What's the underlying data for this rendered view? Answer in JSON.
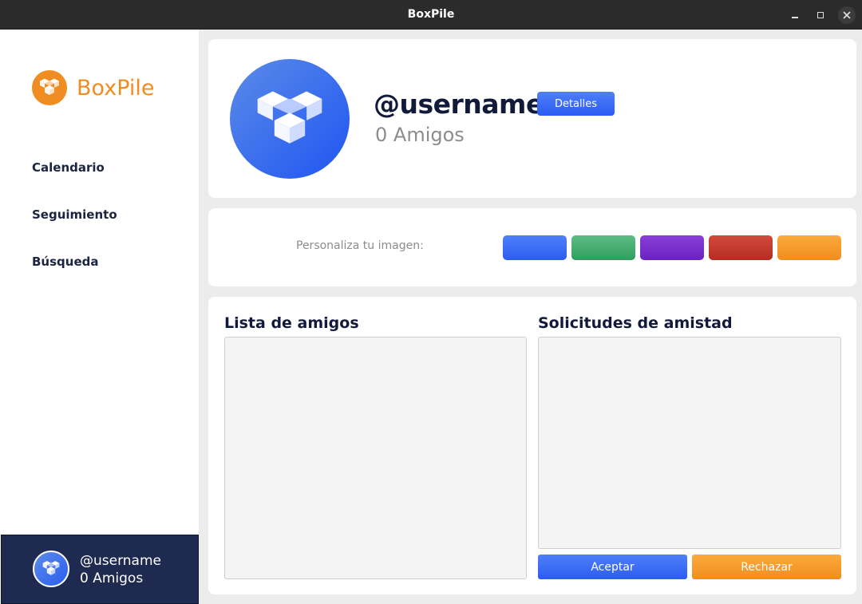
{
  "window": {
    "title": "BoxPile"
  },
  "sidebar": {
    "brand": "BoxPile",
    "nav": [
      {
        "label": "Calendario"
      },
      {
        "label": "Seguimiento"
      },
      {
        "label": "Búsqueda"
      }
    ],
    "user": {
      "username": "@username",
      "friends": "0 Amigos"
    }
  },
  "profile": {
    "username": "@username",
    "friends": "0 Amigos",
    "details_button": "Detalles"
  },
  "customize": {
    "label": "Personaliza tu imagen:",
    "colors": [
      {
        "name": "blue",
        "hex": "#3d6ef5"
      },
      {
        "name": "green",
        "hex": "#45ad70"
      },
      {
        "name": "purple",
        "hex": "#7a30cc"
      },
      {
        "name": "red",
        "hex": "#c43b2e"
      },
      {
        "name": "orange",
        "hex": "#f69b2d"
      }
    ]
  },
  "friends_list": {
    "title": "Lista de amigos",
    "items": []
  },
  "friend_requests": {
    "title": "Solicitudes de amistad",
    "items": [],
    "accept_label": "Aceptar",
    "reject_label": "Rechazar"
  },
  "colors": {
    "accent_orange": "#ef8d22",
    "accent_blue": "#2c5cf2",
    "sidebar_user_bg": "#1e2a50",
    "heading_text": "#111a3a"
  }
}
